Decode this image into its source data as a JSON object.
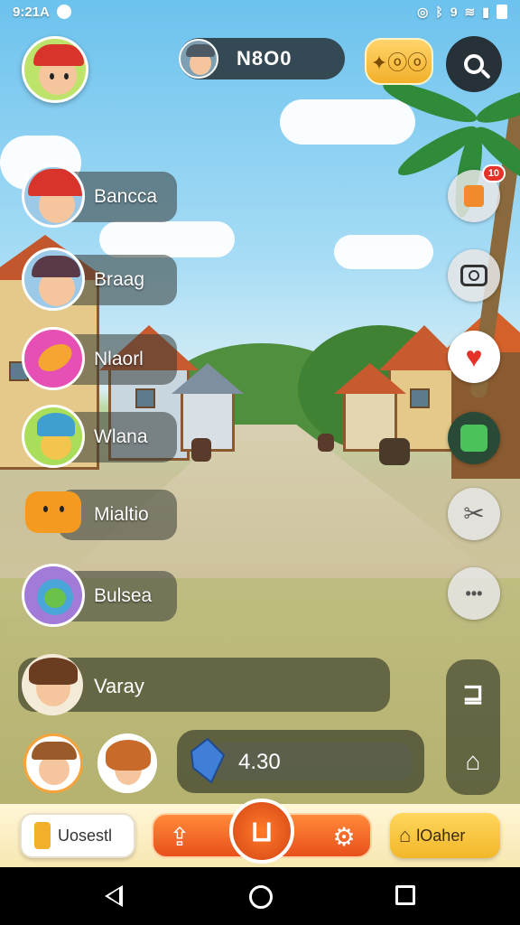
{
  "status_bar": {
    "time": "9:21A",
    "right_text": "9"
  },
  "top_bar": {
    "score": "N8O0",
    "coins_symbol": "✦ⓞⓞ"
  },
  "friends": [
    {
      "name": "Bancca"
    },
    {
      "name": "Braag"
    },
    {
      "name": "Nlaorl"
    },
    {
      "name": "Wlana"
    },
    {
      "name": "Mialtio"
    },
    {
      "name": "Bulsea"
    }
  ],
  "side_buttons": {
    "notification_badge": "10",
    "more_label": "•••"
  },
  "bottom_panel": {
    "user_name": "Varay",
    "gem_value": "4.30",
    "stack_top": "⊒",
    "stack_bottom": "⌂"
  },
  "nav": {
    "left_label": "Uosestl",
    "right_label": "lOaher"
  }
}
